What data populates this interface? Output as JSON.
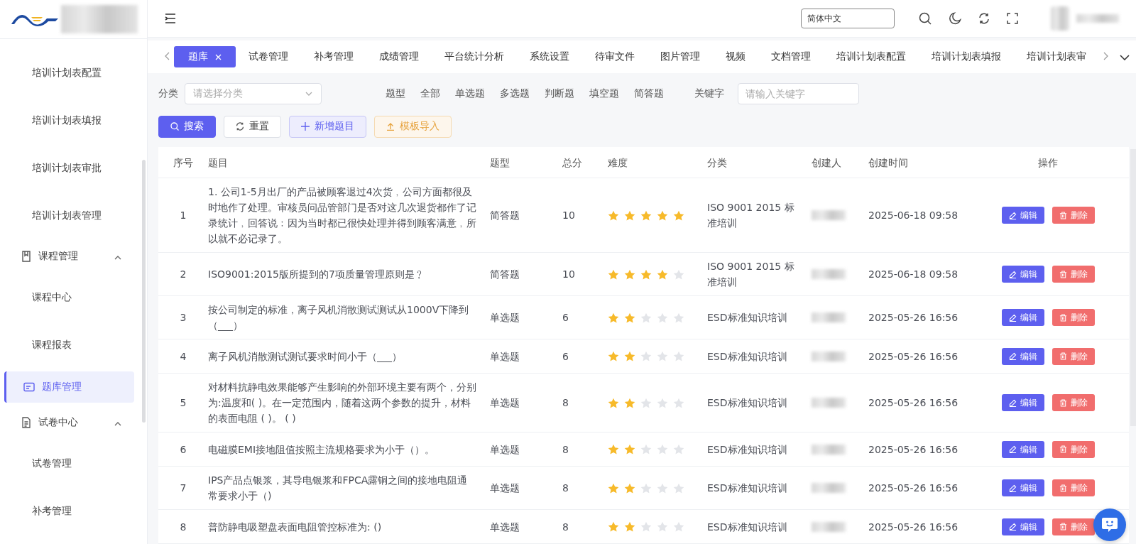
{
  "sidebar": {
    "items": [
      {
        "kind": "subitem",
        "label": "培训计划表配置",
        "selected": false
      },
      {
        "kind": "subitem",
        "label": "培训计划表填报",
        "selected": false
      },
      {
        "kind": "subitem",
        "label": "培训计划表审批",
        "selected": false
      },
      {
        "kind": "subitem",
        "label": "培训计划表管理",
        "selected": false
      },
      {
        "kind": "group",
        "label": "课程管理",
        "expanded": true,
        "children": [
          {
            "kind": "subitem",
            "label": "课程中心",
            "selected": false
          },
          {
            "kind": "subitem",
            "label": "课程报表",
            "selected": false
          }
        ]
      },
      {
        "kind": "link",
        "label": "题库管理",
        "selected": true
      },
      {
        "kind": "group",
        "label": "试卷中心",
        "expanded": true,
        "children": [
          {
            "kind": "subitem",
            "label": "试卷管理",
            "selected": false
          },
          {
            "kind": "subitem",
            "label": "补考管理",
            "selected": false
          }
        ]
      }
    ]
  },
  "header": {
    "language": "简体中文"
  },
  "tabs": [
    {
      "label": "题库",
      "selected": true
    },
    {
      "label": "试卷管理",
      "selected": false
    },
    {
      "label": "补考管理",
      "selected": false
    },
    {
      "label": "成绩管理",
      "selected": false
    },
    {
      "label": "平台统计分析",
      "selected": false
    },
    {
      "label": "系统设置",
      "selected": false
    },
    {
      "label": "待审文件",
      "selected": false
    },
    {
      "label": "图片管理",
      "selected": false
    },
    {
      "label": "视频",
      "selected": false
    },
    {
      "label": "文档管理",
      "selected": false
    },
    {
      "label": "培训计划表配置",
      "selected": false
    },
    {
      "label": "培训计划表填报",
      "selected": false
    },
    {
      "label": "培训计划表审",
      "selected": false
    }
  ],
  "filters": {
    "category": {
      "label": "分类",
      "placeholder": "请选择分类"
    },
    "question_type": {
      "label": "题型",
      "options": [
        "全部",
        "单选题",
        "多选题",
        "判断题",
        "填空题",
        "简答题"
      ]
    },
    "keyword": {
      "label": "关键字",
      "placeholder": "请输入关键字"
    }
  },
  "buttons": [
    {
      "kind": "primary",
      "label": "搜索"
    },
    {
      "kind": "default",
      "label": "重置"
    },
    {
      "kind": "light",
      "label": "新增题目"
    },
    {
      "kind": "warning",
      "label": "模板导入"
    }
  ],
  "table": {
    "columns": [
      "序号",
      "题目",
      "题型",
      "总分",
      "难度",
      "分类",
      "创建人",
      "创建时间",
      "操作"
    ],
    "rows": [
      {
        "index": "1",
        "title": "1. 公司1-5月出厂的产品被顾客退过4次货﹐公司方面都很及时地作了处理。审核员问品管部门是否对这几次退货都作了记录统计﹐回答说﹕因为当时都已很快处理并得到顾客满意﹐所以就不必记录了。",
        "type": "简答题",
        "score": "10",
        "stars": 5,
        "category": "ISO 9001 2015 标准培训",
        "created": "2025-06-18 09:58",
        "actions": [
          {
            "kind": "edit",
            "label": "编辑"
          },
          {
            "kind": "delete",
            "label": "删除"
          }
        ]
      },
      {
        "index": "2",
        "title": "ISO9001:2015版所提到的7项质量管理原则是﹖",
        "type": "简答题",
        "score": "10",
        "stars": 4,
        "category": "ISO 9001 2015 标准培训",
        "created": "2025-06-18 09:58",
        "actions": [
          {
            "kind": "edit",
            "label": "编辑"
          },
          {
            "kind": "delete",
            "label": "删除"
          }
        ]
      },
      {
        "index": "3",
        "title": "按公司制定的标准，离子风机消散测试测试从1000V下降到（___）",
        "type": "单选题",
        "score": "6",
        "stars": 2,
        "category": "ESD标准知识培训",
        "created": "2025-05-26 16:56",
        "actions": [
          {
            "kind": "edit",
            "label": "编辑"
          },
          {
            "kind": "delete",
            "label": "删除"
          }
        ]
      },
      {
        "index": "4",
        "title": "离子风机消散测试测试要求时间小于（___）",
        "type": "单选题",
        "score": "6",
        "stars": 2,
        "category": "ESD标准知识培训",
        "created": "2025-05-26 16:56",
        "actions": [
          {
            "kind": "edit",
            "label": "编辑"
          },
          {
            "kind": "delete",
            "label": "删除"
          }
        ]
      },
      {
        "index": "5",
        "title": "对材料抗静电效果能够产生影响的外部环境主要有两个，分别为:温度和( )。在一定范围内，随着这两个参数的提升，材料的表面电阻 ( )。 ( )",
        "type": "单选题",
        "score": "8",
        "stars": 2,
        "category": "ESD标准知识培训",
        "created": "2025-05-26 16:56",
        "actions": [
          {
            "kind": "edit",
            "label": "编辑"
          },
          {
            "kind": "delete",
            "label": "删除"
          }
        ]
      },
      {
        "index": "6",
        "title": "电磁膜EMI接地阻值按照主流规格要求为小于（）。",
        "type": "单选题",
        "score": "8",
        "stars": 2,
        "category": "ESD标准知识培训",
        "created": "2025-05-26 16:56",
        "actions": [
          {
            "kind": "edit",
            "label": "编辑"
          },
          {
            "kind": "delete",
            "label": "删除"
          }
        ]
      },
      {
        "index": "7",
        "title": "IPS产品点银浆，其导电银浆和FPCA露铜之间的接地电阻通常要求小于（)",
        "type": "单选题",
        "score": "8",
        "stars": 2,
        "category": "ESD标准知识培训",
        "created": "2025-05-26 16:56",
        "actions": [
          {
            "kind": "edit",
            "label": "编辑"
          },
          {
            "kind": "delete",
            "label": "删除"
          }
        ]
      },
      {
        "index": "8",
        "title": "普防静电吸塑盘表面电阻管控标准为: ()",
        "type": "单选题",
        "score": "8",
        "stars": 2,
        "category": "ESD标准知识培训",
        "created": "2025-05-26 16:56",
        "actions": [
          {
            "kind": "edit",
            "label": "编辑"
          },
          {
            "kind": "delete",
            "label": "删除"
          }
        ]
      }
    ]
  }
}
